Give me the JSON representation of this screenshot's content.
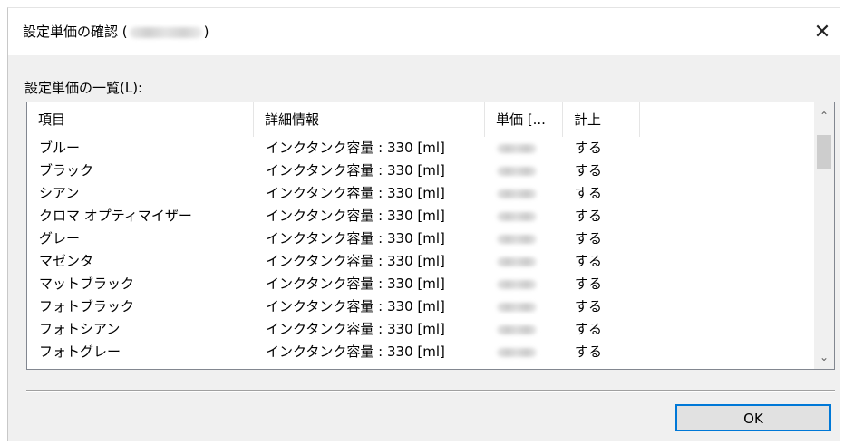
{
  "dialog": {
    "title_prefix": "設定単価の確認 (",
    "title_suffix": ")",
    "close_glyph": "✕"
  },
  "list": {
    "label": "設定単価の一覧(L):",
    "columns": [
      "項目",
      "詳細情報",
      "単価 [...",
      "計上"
    ],
    "rows": [
      {
        "item": "ブルー",
        "detail": "インクタンク容量 : 330 [ml]",
        "count": "する"
      },
      {
        "item": "ブラック",
        "detail": "インクタンク容量 : 330 [ml]",
        "count": "する"
      },
      {
        "item": "シアン",
        "detail": "インクタンク容量 : 330 [ml]",
        "count": "する"
      },
      {
        "item": "クロマ オプティマイザー",
        "detail": "インクタンク容量 : 330 [ml]",
        "count": "する"
      },
      {
        "item": "グレー",
        "detail": "インクタンク容量 : 330 [ml]",
        "count": "する"
      },
      {
        "item": "マゼンタ",
        "detail": "インクタンク容量 : 330 [ml]",
        "count": "する"
      },
      {
        "item": "マットブラック",
        "detail": "インクタンク容量 : 330 [ml]",
        "count": "する"
      },
      {
        "item": "フォトブラック",
        "detail": "インクタンク容量 : 330 [ml]",
        "count": "する"
      },
      {
        "item": "フォトシアン",
        "detail": "インクタンク容量 : 330 [ml]",
        "count": "する"
      },
      {
        "item": "フォトグレー",
        "detail": "インクタンク容量 : 330 [ml]",
        "count": "する"
      }
    ],
    "scroll_up_glyph": "⌃",
    "scroll_down_glyph": "⌄"
  },
  "buttons": {
    "ok": "OK"
  },
  "colors": {
    "dialog_bg": "#f0f0f0",
    "focus_border": "#0078d7"
  }
}
